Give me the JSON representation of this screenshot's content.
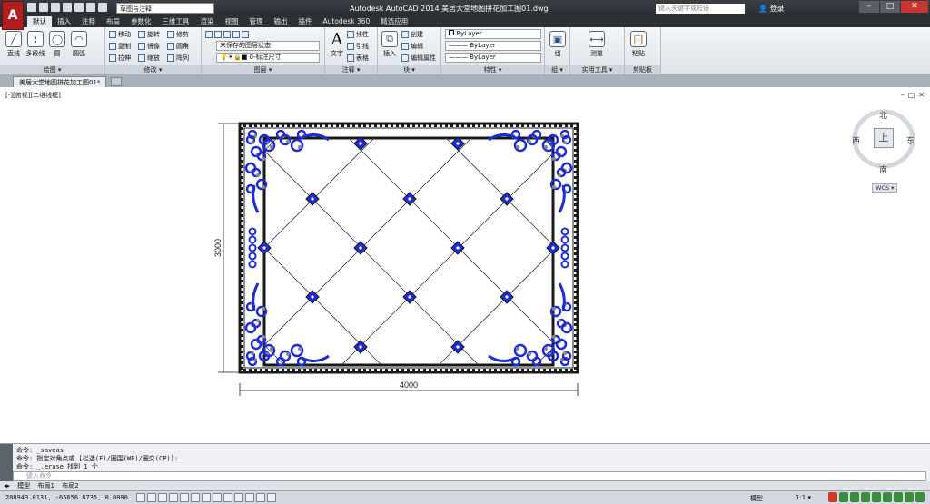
{
  "window": {
    "title": "Autodesk AutoCAD 2014    美居大堂地图拼花加工图01.dwg",
    "workspace": "草图与注释",
    "search_placeholder": "键入关键字或短语",
    "login": "登录"
  },
  "ribbon_tabs": [
    "默认",
    "插入",
    "注释",
    "布局",
    "参数化",
    "三维工具",
    "渲染",
    "视图",
    "管理",
    "输出",
    "插件",
    "Autodesk 360",
    "精选应用"
  ],
  "ribbon": {
    "draw": {
      "title": "绘图 ▾",
      "tools": [
        "直线",
        "多段线",
        "圆",
        "圆弧"
      ]
    },
    "modify": {
      "title": "修改 ▾",
      "tools": [
        "移动",
        "旋转",
        "修剪",
        "复制",
        "镜像",
        "圆角",
        "拉伸",
        "缩放",
        "阵列"
      ]
    },
    "layers": {
      "title": "图层 ▾",
      "layer_state": "未保存的图层状态",
      "current_layer": "0-标注尺寸"
    },
    "annotation": {
      "title": "注释 ▾",
      "tools": [
        "文字",
        "线性",
        "引线",
        "表格"
      ]
    },
    "block": {
      "title": "块 ▾",
      "tools": [
        "插入",
        "创建",
        "编辑",
        "编辑属性"
      ]
    },
    "properties": {
      "title": "特性 ▾",
      "color": "ByLayer",
      "linetype": "ByLayer",
      "lineweight": "ByLayer"
    },
    "groups": {
      "title": "组 ▾",
      "tool": "组"
    },
    "utilities": {
      "title": "实用工具 ▾",
      "tool": "测量"
    },
    "clipboard": {
      "title": "剪贴板",
      "tool": "粘贴"
    }
  },
  "doc_tab": "美居大堂地图拼花加工图01*",
  "viewport": {
    "label": "[-][俯视][二维线框]",
    "compass": {
      "north": "北",
      "south": "南",
      "east": "东",
      "west": "西",
      "face": "上"
    },
    "wcs": "WCS ▾"
  },
  "drawing": {
    "width_dim": "4000",
    "height_dim": "3000",
    "colors": {
      "blue": "#1f2bd6",
      "dark": "#1a1a1a",
      "line": "#3a3a3a"
    }
  },
  "command": {
    "history": [
      "命令:  _saveas",
      "命令: 指定对角点或 [栏选(F)/圈围(WP)/圈交(CP)]:",
      "命令:  _.erase 找到 1 个"
    ],
    "placeholder": "键入命令"
  },
  "layout_tabs": [
    "模型",
    "布局1",
    "布局2"
  ],
  "status": {
    "coords": "208943.0131, -65656.8735, 0.0000",
    "model": "模型",
    "scale": "1:1 ▾"
  }
}
